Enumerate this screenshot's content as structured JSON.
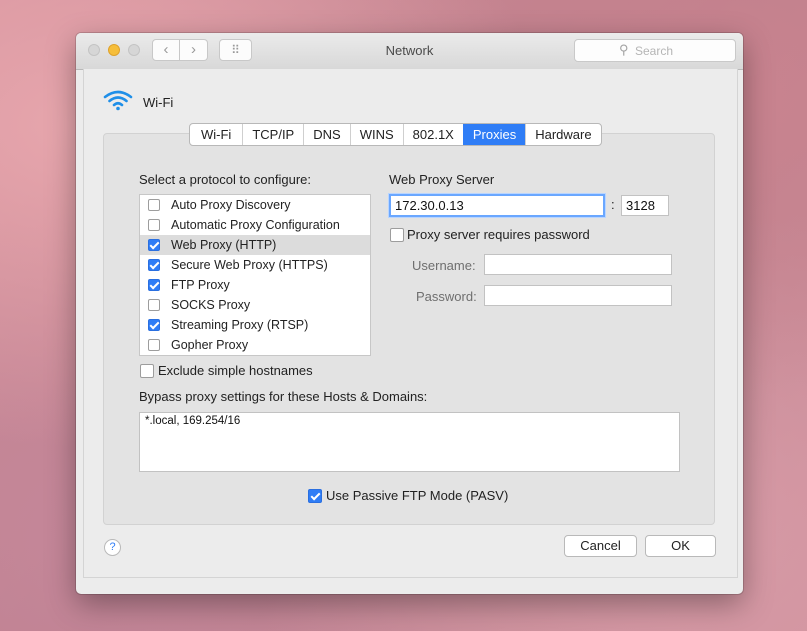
{
  "window": {
    "title": "Network",
    "search_placeholder": "Search"
  },
  "toolbar": {
    "back_glyph": "‹",
    "forward_glyph": "›",
    "grid_glyph": "⠿"
  },
  "interface": {
    "name": "Wi-Fi",
    "icon": "wifi-icon"
  },
  "tabs": [
    {
      "label": "Wi-Fi",
      "active": false
    },
    {
      "label": "TCP/IP",
      "active": false
    },
    {
      "label": "DNS",
      "active": false
    },
    {
      "label": "WINS",
      "active": false
    },
    {
      "label": "802.1X",
      "active": false
    },
    {
      "label": "Proxies",
      "active": true
    },
    {
      "label": "Hardware",
      "active": false
    }
  ],
  "proxies": {
    "protocol_heading": "Select a protocol to configure:",
    "protocols": [
      {
        "label": "Auto Proxy Discovery",
        "checked": false,
        "selected": false
      },
      {
        "label": "Automatic Proxy Configuration",
        "checked": false,
        "selected": false
      },
      {
        "label": "Web Proxy (HTTP)",
        "checked": true,
        "selected": true
      },
      {
        "label": "Secure Web Proxy (HTTPS)",
        "checked": true,
        "selected": false
      },
      {
        "label": "FTP Proxy",
        "checked": true,
        "selected": false
      },
      {
        "label": "SOCKS Proxy",
        "checked": false,
        "selected": false
      },
      {
        "label": "Streaming Proxy (RTSP)",
        "checked": true,
        "selected": false
      },
      {
        "label": "Gopher Proxy",
        "checked": false,
        "selected": false
      }
    ],
    "exclude_simple": {
      "label": "Exclude simple hostnames",
      "checked": false
    },
    "server_heading": "Web Proxy Server",
    "server_address": "172.30.0.13",
    "port_separator": ":",
    "port": "3128",
    "requires_password": {
      "label": "Proxy server requires password",
      "checked": false
    },
    "username_label": "Username:",
    "username_value": "",
    "password_label": "Password:",
    "password_value": "",
    "bypass_heading": "Bypass proxy settings for these Hosts & Domains:",
    "bypass_value": "*.local, 169.254/16",
    "passive_ftp": {
      "label": "Use Passive FTP Mode (PASV)",
      "checked": true
    }
  },
  "footer": {
    "help_glyph": "?",
    "cancel_label": "Cancel",
    "ok_label": "OK"
  },
  "colors": {
    "accent": "#2f7df6",
    "window_bg": "#ececec"
  }
}
